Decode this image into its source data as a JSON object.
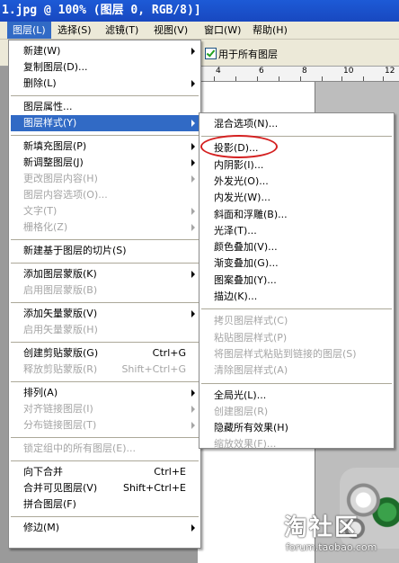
{
  "window": {
    "title": "1.jpg @ 100% (图层 0, RGB/8)]"
  },
  "menubar": [
    {
      "label": "图层(L)",
      "active": true
    },
    {
      "label": "选择(S)"
    },
    {
      "label": "滤镜(T)"
    },
    {
      "label": "视图(V)"
    },
    {
      "label": "窗口(W)"
    },
    {
      "label": "帮助(H)"
    }
  ],
  "options": {
    "all_layers_label": "用于所有图层",
    "all_layers_checked": true
  },
  "ruler": {
    "labels": [
      "4",
      "6",
      "8",
      "10",
      "12"
    ]
  },
  "layer_menu": [
    {
      "label": "新建(W)",
      "submenu": true
    },
    {
      "label": "复制图层(D)..."
    },
    {
      "label": "删除(L)",
      "submenu": true
    },
    {
      "sep": true
    },
    {
      "label": "图层属性..."
    },
    {
      "label": "图层样式(Y)",
      "submenu": true,
      "highlighted": true
    },
    {
      "sep": true
    },
    {
      "label": "新填充图层(P)",
      "submenu": true
    },
    {
      "label": "新调整图层(J)",
      "submenu": true
    },
    {
      "label": "更改图层内容(H)",
      "submenu": true,
      "disabled": true
    },
    {
      "label": "图层内容选项(O)...",
      "disabled": true
    },
    {
      "label": "文字(T)",
      "submenu": true,
      "disabled": true
    },
    {
      "label": "栅格化(Z)",
      "submenu": true,
      "disabled": true
    },
    {
      "sep": true
    },
    {
      "label": "新建基于图层的切片(S)"
    },
    {
      "sep": true
    },
    {
      "label": "添加图层蒙版(K)",
      "submenu": true
    },
    {
      "label": "启用图层蒙版(B)",
      "disabled": true
    },
    {
      "sep": true
    },
    {
      "label": "添加矢量蒙版(V)",
      "submenu": true
    },
    {
      "label": "启用矢量蒙版(H)",
      "disabled": true
    },
    {
      "sep": true
    },
    {
      "label": "创建剪贴蒙版(G)",
      "shortcut": "Ctrl+G"
    },
    {
      "label": "释放剪贴蒙版(R)",
      "shortcut": "Shift+Ctrl+G",
      "disabled": true
    },
    {
      "sep": true
    },
    {
      "label": "排列(A)",
      "submenu": true
    },
    {
      "label": "对齐链接图层(I)",
      "submenu": true,
      "disabled": true
    },
    {
      "label": "分布链接图层(T)",
      "submenu": true,
      "disabled": true
    },
    {
      "sep": true
    },
    {
      "label": "锁定组中的所有图层(E)...",
      "disabled": true
    },
    {
      "sep": true
    },
    {
      "label": "向下合并",
      "shortcut": "Ctrl+E"
    },
    {
      "label": "合并可见图层(V)",
      "shortcut": "Shift+Ctrl+E"
    },
    {
      "label": "拼合图层(F)"
    },
    {
      "sep": true
    },
    {
      "label": "修边(M)",
      "submenu": true
    }
  ],
  "style_menu": [
    {
      "label": "混合选项(N)..."
    },
    {
      "sep": true
    },
    {
      "label": "投影(D)..."
    },
    {
      "label": "内阴影(I)..."
    },
    {
      "label": "外发光(O)..."
    },
    {
      "label": "内发光(W)..."
    },
    {
      "label": "斜面和浮雕(B)..."
    },
    {
      "label": "光泽(T)..."
    },
    {
      "label": "颜色叠加(V)..."
    },
    {
      "label": "渐变叠加(G)..."
    },
    {
      "label": "图案叠加(Y)..."
    },
    {
      "label": "描边(K)..."
    },
    {
      "sep": true
    },
    {
      "label": "拷贝图层样式(C)",
      "disabled": true
    },
    {
      "label": "粘贴图层样式(P)",
      "disabled": true
    },
    {
      "label": "将图层样式粘贴到链接的图层(S)",
      "disabled": true
    },
    {
      "label": "清除图层样式(A)",
      "disabled": true
    },
    {
      "sep": true
    },
    {
      "label": "全局光(L)..."
    },
    {
      "label": "创建图层(R)",
      "disabled": true
    },
    {
      "label": "隐藏所有效果(H)"
    },
    {
      "label": "缩放效果(F)...",
      "disabled": true
    }
  ],
  "watermark": {
    "logo": "淘社区",
    "site": "forum.taobao.com"
  }
}
